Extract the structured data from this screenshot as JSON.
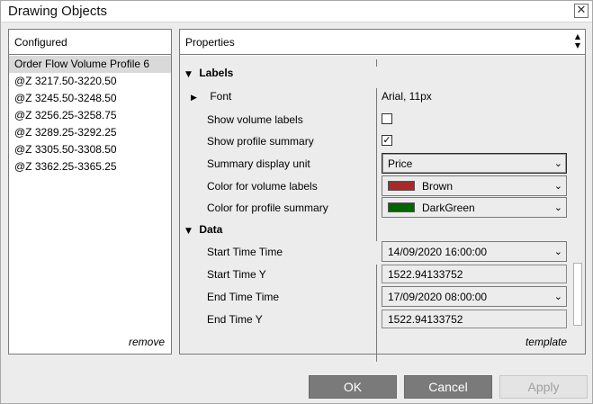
{
  "window": {
    "title": "Drawing Objects",
    "close_glyph": "✕"
  },
  "configured": {
    "header": "Configured",
    "items": [
      "Order Flow Volume Profile 6",
      "@Z 3217.50-3220.50",
      "@Z 3245.50-3248.50",
      "@Z 3256.25-3258.75",
      "@Z 3289.25-3292.25",
      "@Z 3305.50-3308.50",
      "@Z 3362.25-3365.25"
    ],
    "selected_index": 0,
    "remove_label": "remove"
  },
  "properties": {
    "header": "Properties",
    "scroll_up": "▲",
    "scroll_down": "▼",
    "sections": {
      "labels": "Labels",
      "data": "Data"
    },
    "font": {
      "label": "Font",
      "value": "Arial, 11px"
    },
    "show_volume_labels": {
      "label": "Show volume labels",
      "checked": false
    },
    "show_profile_summary": {
      "label": "Show profile summary",
      "checked": true,
      "check_glyph": "✓"
    },
    "summary_display_unit": {
      "label": "Summary display unit",
      "value": "Price"
    },
    "color_volume_labels": {
      "label": "Color for volume labels",
      "value": "Brown",
      "color": "#a52a2a"
    },
    "color_profile_summary": {
      "label": "Color for profile summary",
      "value": "DarkGreen",
      "color": "#006400"
    },
    "start_time_time": {
      "label": "Start Time Time",
      "value": "14/09/2020 16:00:00"
    },
    "start_time_y": {
      "label": "Start Time Y",
      "value": "1522.94133752"
    },
    "end_time_time": {
      "label": "End Time Time",
      "value": "17/09/2020 08:00:00"
    },
    "end_time_y": {
      "label": "End Time Y",
      "value": "1522.94133752"
    },
    "template_label": "template",
    "expanded_glyph": "▼",
    "collapsed_glyph": "▶",
    "dropdown_glyph": "⌄"
  },
  "buttons": {
    "ok": "OK",
    "cancel": "Cancel",
    "apply": "Apply"
  }
}
